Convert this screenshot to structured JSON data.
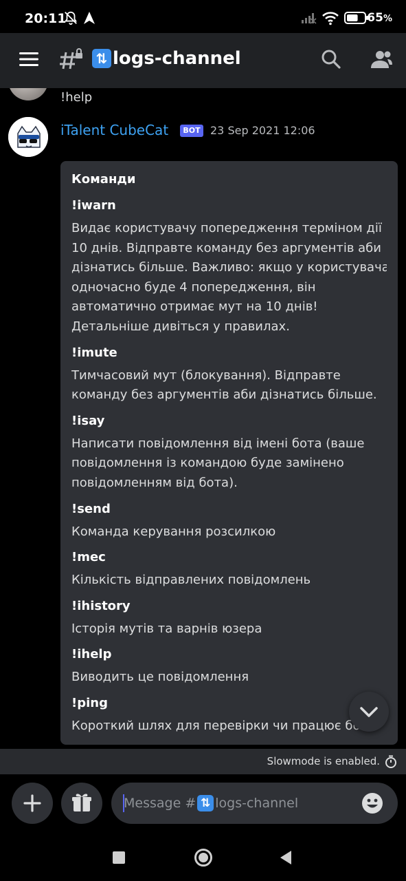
{
  "status_bar": {
    "time": "20:11",
    "battery": "65",
    "battery_unit": "%",
    "battery_level": 0.65
  },
  "header": {
    "menu_icon": "hamburger-icon",
    "channel_icon": "hash-lock-icon",
    "channel_emoji": "arrows-cycle-emoji",
    "channel_name": "logs-channel",
    "search_icon": "search-icon",
    "members_icon": "members-icon"
  },
  "previous_message": {
    "text": "!help"
  },
  "bot_message": {
    "author": "iTalent CubeCat",
    "badge": "BOT",
    "timestamp": "23 Sep 2021 12:06",
    "embed": {
      "title": "Команди",
      "fields": [
        {
          "name": "!iwarn",
          "lines": [
            "Видає користувачу попередження терміном дії",
            "10 днів. Відправте команду без аргументів аби",
            "дізнатись більше. Важливо: якщо у користувача",
            "одночасно буде 4 попередження, він",
            "автоматично отримає мут на 10 днів!",
            "Детальніше дивіться у правилах."
          ]
        },
        {
          "name": "!imute",
          "lines": [
            "Тимчасовий мут (блокування). Відправте",
            "команду без аргументів аби дізнатись більше."
          ]
        },
        {
          "name": "!isay",
          "lines": [
            "Написати повідомлення від імені бота (ваше",
            "повідомлення із командою буде замінено",
            "повідомленням від бота)."
          ]
        },
        {
          "name": "!send",
          "lines": [
            "Команда керування розсилкою"
          ]
        },
        {
          "name": "!mec",
          "lines": [
            "Кількість відправлених повідомлень"
          ]
        },
        {
          "name": "!ihistory",
          "lines": [
            "Історія мутів та варнів юзера"
          ]
        },
        {
          "name": "!ihelp",
          "lines": [
            "Виводить це повідомлення"
          ]
        },
        {
          "name": "!ping",
          "lines": [
            "Короткий шлях для перевірки чи працює бот"
          ]
        }
      ]
    }
  },
  "slowmode": {
    "text": "Slowmode is enabled."
  },
  "composer": {
    "placeholder_prefix": "Message #",
    "placeholder_channel": "logs-channel"
  },
  "colors": {
    "accent": "#5865f2",
    "author": "#3ea2f2",
    "embed_bg": "#2f3136",
    "header_bg": "#202225"
  }
}
